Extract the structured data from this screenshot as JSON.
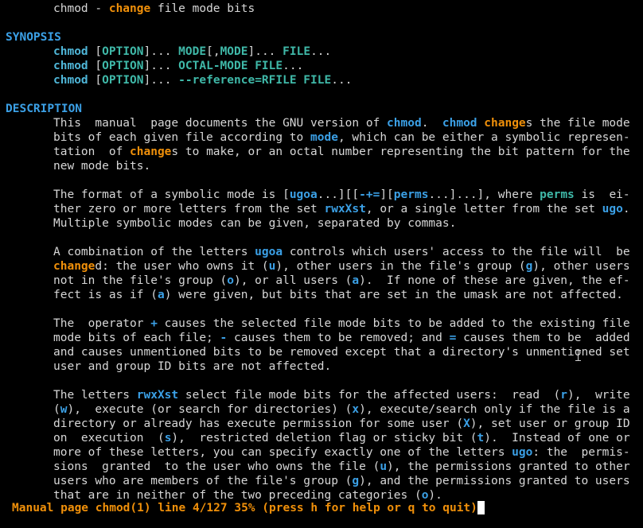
{
  "title_line": [
    {
      "t": "chmod - ",
      "c": "plain"
    },
    {
      "t": "change",
      "c": "orange"
    },
    {
      "t": " file mode bits",
      "c": "plain"
    }
  ],
  "synopsis": {
    "heading": "SYNOPSIS",
    "lines": [
      [
        {
          "t": "chmod",
          "c": "cyan"
        },
        {
          "t": " [",
          "c": "plain"
        },
        {
          "t": "OPTION",
          "c": "teal"
        },
        {
          "t": "]... ",
          "c": "plain"
        },
        {
          "t": "MODE",
          "c": "teal"
        },
        {
          "t": "[,",
          "c": "plain"
        },
        {
          "t": "MODE",
          "c": "teal"
        },
        {
          "t": "]... ",
          "c": "plain"
        },
        {
          "t": "FILE",
          "c": "teal"
        },
        {
          "t": "...",
          "c": "plain"
        }
      ],
      [
        {
          "t": "chmod",
          "c": "cyan"
        },
        {
          "t": " [",
          "c": "plain"
        },
        {
          "t": "OPTION",
          "c": "teal"
        },
        {
          "t": "]... ",
          "c": "plain"
        },
        {
          "t": "OCTAL-MODE FILE",
          "c": "teal"
        },
        {
          "t": "...",
          "c": "plain"
        }
      ],
      [
        {
          "t": "chmod",
          "c": "cyan"
        },
        {
          "t": " [",
          "c": "plain"
        },
        {
          "t": "OPTION",
          "c": "teal"
        },
        {
          "t": "]... ",
          "c": "plain"
        },
        {
          "t": "--reference=RFILE FILE",
          "c": "teal"
        },
        {
          "t": "...",
          "c": "plain"
        }
      ]
    ]
  },
  "description": {
    "heading": "DESCRIPTION",
    "paragraphs": [
      [
        [
          {
            "t": "This  manual  page documents the GNU version of ",
            "c": "plain"
          },
          {
            "t": "chmod",
            "c": "blue"
          },
          {
            "t": ".  ",
            "c": "plain"
          },
          {
            "t": "chmod",
            "c": "blue"
          },
          {
            "t": " ",
            "c": "plain"
          },
          {
            "t": "change",
            "c": "orange"
          },
          {
            "t": "s the file mode",
            "c": "plain"
          }
        ],
        [
          {
            "t": "bits of each given file according to ",
            "c": "plain"
          },
          {
            "t": "mode",
            "c": "blue"
          },
          {
            "t": ", which can be either a symbolic represen-",
            "c": "plain"
          }
        ],
        [
          {
            "t": "tation  of ",
            "c": "plain"
          },
          {
            "t": "change",
            "c": "orange"
          },
          {
            "t": "s to make, or an octal number representing the bit pattern for the",
            "c": "plain"
          }
        ],
        [
          {
            "t": "new mode bits.",
            "c": "plain"
          }
        ]
      ],
      [
        [
          {
            "t": "The format of a symbolic mode is [",
            "c": "plain"
          },
          {
            "t": "ugoa",
            "c": "blue"
          },
          {
            "t": "...][[",
            "c": "plain"
          },
          {
            "t": "-+=",
            "c": "blue"
          },
          {
            "t": "][",
            "c": "plain"
          },
          {
            "t": "perms",
            "c": "blue"
          },
          {
            "t": "...]...], where ",
            "c": "plain"
          },
          {
            "t": "perms",
            "c": "teal"
          },
          {
            "t": " is  ei-",
            "c": "plain"
          }
        ],
        [
          {
            "t": "ther zero or more letters from the set ",
            "c": "plain"
          },
          {
            "t": "rwxXst",
            "c": "blue"
          },
          {
            "t": ", or a single letter from the set ",
            "c": "plain"
          },
          {
            "t": "ugo",
            "c": "blue"
          },
          {
            "t": ".",
            "c": "plain"
          }
        ],
        [
          {
            "t": "Multiple symbolic modes can be given, separated by commas.",
            "c": "plain"
          }
        ]
      ],
      [
        [
          {
            "t": "A combination of the letters ",
            "c": "plain"
          },
          {
            "t": "ugoa",
            "c": "blue"
          },
          {
            "t": " controls which users' access to the file will  be",
            "c": "plain"
          }
        ],
        [
          {
            "t": "change",
            "c": "orange"
          },
          {
            "t": "d: the user who owns it (",
            "c": "plain"
          },
          {
            "t": "u",
            "c": "blue"
          },
          {
            "t": "), other users in the file's group (",
            "c": "plain"
          },
          {
            "t": "g",
            "c": "blue"
          },
          {
            "t": "), other users",
            "c": "plain"
          }
        ],
        [
          {
            "t": "not in the file's group (",
            "c": "plain"
          },
          {
            "t": "o",
            "c": "blue"
          },
          {
            "t": "), or all users (",
            "c": "plain"
          },
          {
            "t": "a",
            "c": "blue"
          },
          {
            "t": ").  If none of these are given, the ef-",
            "c": "plain"
          }
        ],
        [
          {
            "t": "fect is as if (",
            "c": "plain"
          },
          {
            "t": "a",
            "c": "blue"
          },
          {
            "t": ") were given, but bits that are set in the umask are not affected.",
            "c": "plain"
          }
        ]
      ],
      [
        [
          {
            "t": "The  operator ",
            "c": "plain"
          },
          {
            "t": "+",
            "c": "blue"
          },
          {
            "t": " causes the selected file mode bits to be added to the existing file",
            "c": "plain"
          }
        ],
        [
          {
            "t": "mode bits of each file; ",
            "c": "plain"
          },
          {
            "t": "-",
            "c": "blue"
          },
          {
            "t": " causes them to be removed; and ",
            "c": "plain"
          },
          {
            "t": "=",
            "c": "blue"
          },
          {
            "t": " causes them to be  added",
            "c": "plain"
          }
        ],
        [
          {
            "t": "and causes unmentioned bits to be removed except that a directory's unmentioned set",
            "c": "plain"
          }
        ],
        [
          {
            "t": "user and group ID bits are not affected.",
            "c": "plain"
          }
        ]
      ],
      [
        [
          {
            "t": "The letters ",
            "c": "plain"
          },
          {
            "t": "rwxXst",
            "c": "blue"
          },
          {
            "t": " select file mode bits for the affected users:  read  (",
            "c": "plain"
          },
          {
            "t": "r",
            "c": "blue"
          },
          {
            "t": "),  write",
            "c": "plain"
          }
        ],
        [
          {
            "t": "(",
            "c": "plain"
          },
          {
            "t": "w",
            "c": "blue"
          },
          {
            "t": "),  execute (or search for directories) (",
            "c": "plain"
          },
          {
            "t": "x",
            "c": "blue"
          },
          {
            "t": "), execute/search only if the file is a",
            "c": "plain"
          }
        ],
        [
          {
            "t": "directory or already has execute permission for some user (",
            "c": "plain"
          },
          {
            "t": "X",
            "c": "blue"
          },
          {
            "t": "), set user or group ID",
            "c": "plain"
          }
        ],
        [
          {
            "t": "on  execution  (",
            "c": "plain"
          },
          {
            "t": "s",
            "c": "blue"
          },
          {
            "t": "),  restricted deletion flag or sticky bit (",
            "c": "plain"
          },
          {
            "t": "t",
            "c": "blue"
          },
          {
            "t": ").  Instead of one or",
            "c": "plain"
          }
        ],
        [
          {
            "t": "more of these letters, you can specify exactly one of the letters ",
            "c": "plain"
          },
          {
            "t": "ugo",
            "c": "blue"
          },
          {
            "t": ": the  permis-",
            "c": "plain"
          }
        ],
        [
          {
            "t": "sions  granted  to the user who owns the file (",
            "c": "plain"
          },
          {
            "t": "u",
            "c": "blue"
          },
          {
            "t": "), the permissions granted to other",
            "c": "plain"
          }
        ],
        [
          {
            "t": "users who are members of the file's group (",
            "c": "plain"
          },
          {
            "t": "g",
            "c": "blue"
          },
          {
            "t": "), and the permissions granted to users",
            "c": "plain"
          }
        ],
        [
          {
            "t": "that are in neither of the two preceding categories (",
            "c": "plain"
          },
          {
            "t": "o",
            "c": "blue"
          },
          {
            "t": ").",
            "c": "plain"
          }
        ]
      ]
    ]
  },
  "status_line": "Manual page chmod(1) line 4/127 35% (press h for help or q to quit)",
  "colors": {
    "background": "#000000",
    "text": "#d7d7d7",
    "heading_blue": "#3ba0e6",
    "command_cyan": "#4fb6d8",
    "arg_teal": "#3fb8a8",
    "highlight_orange": "#f0900a",
    "cursor": "#ffffff"
  },
  "icons": {
    "cursor": "block-cursor-icon",
    "mouse": "text-ibeam-icon"
  }
}
